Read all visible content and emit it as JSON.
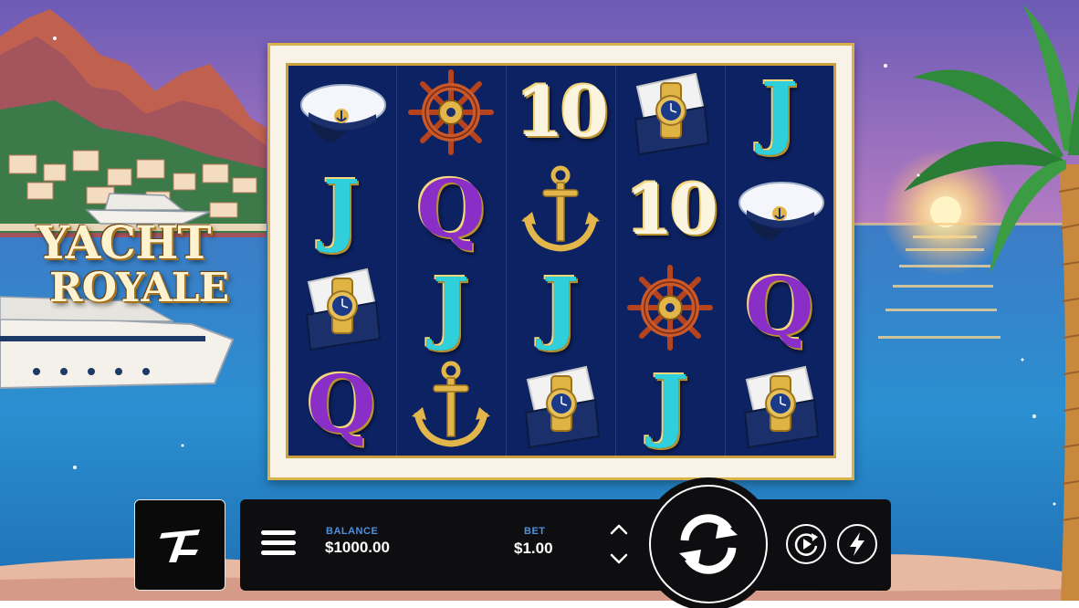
{
  "game": {
    "title_line1": "YACHT",
    "title_line2": "ROYALE"
  },
  "reels": [
    [
      "captain-hat",
      "J",
      "watch",
      "Q"
    ],
    [
      "helm-wheel",
      "Q",
      "J",
      "anchor"
    ],
    [
      "10",
      "anchor",
      "J",
      "watch"
    ],
    [
      "watch",
      "10",
      "helm-wheel",
      "J"
    ],
    [
      "J",
      "captain-hat",
      "Q",
      "watch"
    ]
  ],
  "controls": {
    "brand_logo_icon": "tl-logo-icon",
    "menu_icon": "hamburger-menu-icon",
    "balance_label": "BALANCE",
    "balance_value": "$1000.00",
    "bet_label": "BET",
    "bet_value": "$1.00",
    "bet_increase_icon": "chevron-up-icon",
    "bet_decrease_icon": "chevron-down-icon",
    "spin_icon": "spin-arrows-icon",
    "autoplay_icon": "autoplay-icon",
    "turbo_icon": "lightning-icon"
  },
  "colors": {
    "reel_background": "#0d2262",
    "frame_gold": "#d9b24c",
    "bar_background": "#0e0e10",
    "label_blue": "#4d8fe0",
    "symbol_J": "#2fd0dc",
    "symbol_Q": "#8a2ec8"
  }
}
